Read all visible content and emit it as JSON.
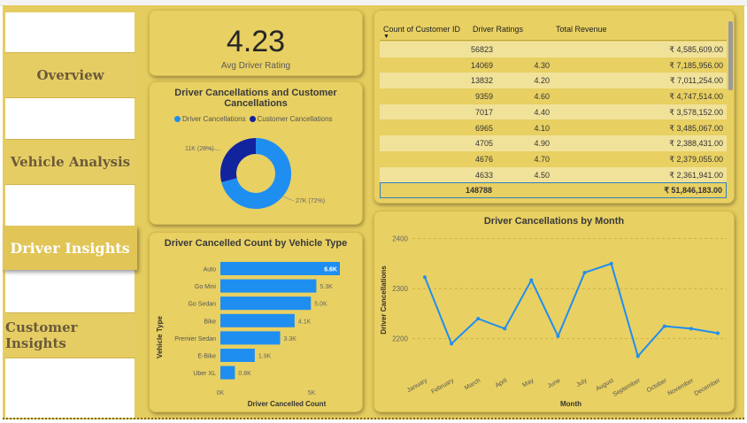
{
  "nav": {
    "overview": "Overview",
    "vehicle_analysis": "Vehicle Analysis",
    "driver_insights": "Driver Insights",
    "customer_insights": "Customer Insights"
  },
  "kpi": {
    "value": "4.23",
    "label": "Avg Driver Rating"
  },
  "donut": {
    "title_line1": "Driver Cancellations and Customer",
    "title_line2": "Cancellations",
    "legend": [
      "Driver Cancellations",
      "Customer Cancellations"
    ],
    "colors": [
      "#1f8ef1",
      "#12239e"
    ],
    "label_customer": "11K (28%)",
    "label_driver": "27K (72%)"
  },
  "table": {
    "headers": [
      "Count of Customer ID",
      "Driver Ratings",
      "Total Revenue"
    ],
    "rows": [
      [
        "56823",
        "",
        "₹ 4,585,609.00"
      ],
      [
        "14069",
        "4.30",
        "₹ 7,185,956.00"
      ],
      [
        "13832",
        "4.20",
        "₹ 7,011,254.00"
      ],
      [
        "9359",
        "4.60",
        "₹ 4,747,514.00"
      ],
      [
        "7017",
        "4.40",
        "₹ 3,578,152.00"
      ],
      [
        "6965",
        "4.10",
        "₹ 3,485,067.00"
      ],
      [
        "4705",
        "4.90",
        "₹ 2,388,431.00"
      ],
      [
        "4676",
        "4.70",
        "₹ 2,379,055.00"
      ],
      [
        "4633",
        "4.50",
        "₹ 2,361,941.00"
      ]
    ],
    "total": [
      "148788",
      "",
      "₹ 51,846,183.00"
    ]
  },
  "chart_data": [
    {
      "type": "pie",
      "title": "Driver Cancellations and Customer Cancellations",
      "categories": [
        "Driver Cancellations",
        "Customer Cancellations"
      ],
      "values": [
        27000,
        11000
      ],
      "percent": [
        72,
        28
      ],
      "data_labels": [
        "27K (72%)",
        "11K (28%)"
      ],
      "legend": "top"
    },
    {
      "type": "bar",
      "title": "Driver Cancelled Count by Vehicle Type",
      "categories": [
        "Auto",
        "Go Mini",
        "Go Sedan",
        "Bike",
        "Premier Sedan",
        "E-Bike",
        "Uber XL"
      ],
      "values": [
        6600,
        5300,
        5000,
        4100,
        3300,
        1900,
        800
      ],
      "data_labels": [
        "6.6K",
        "5.3K",
        "5.0K",
        "4.1K",
        "3.3K",
        "1.9K",
        "0.8K"
      ],
      "xlabel": "Driver Cancelled Count",
      "ylabel": "Vehicle Type",
      "xlim": [
        0,
        6600
      ],
      "x_ticks": [
        "0K",
        "5K"
      ],
      "color": "#1f8ef1"
    },
    {
      "type": "line",
      "title": "Driver Cancellations by Month",
      "x": [
        "January",
        "February",
        "March",
        "April",
        "May",
        "June",
        "July",
        "August",
        "September",
        "October",
        "November",
        "December"
      ],
      "values": [
        2323,
        2190,
        2240,
        2220,
        2317,
        2205,
        2332,
        2350,
        2165,
        2225,
        2220,
        2211
      ],
      "xlabel": "Month",
      "ylabel": "Driver Cancellations",
      "ylim": [
        2150,
        2410
      ],
      "y_ticks": [
        "2200",
        "2300",
        "2400"
      ],
      "grid": true,
      "color": "#1f8ef1"
    }
  ]
}
